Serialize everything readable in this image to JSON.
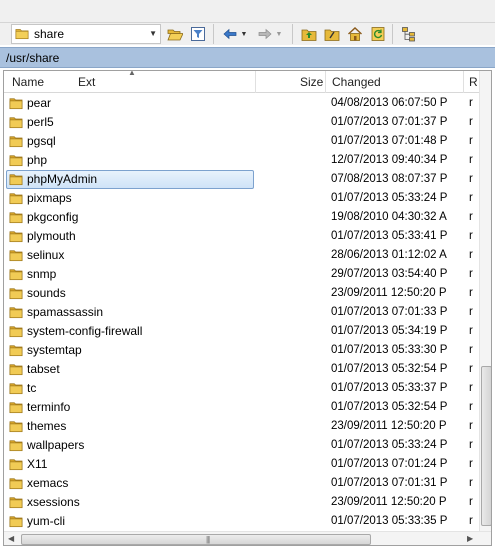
{
  "toolbar": {
    "location": "share",
    "buttons": [
      "folder-open",
      "filter",
      "back",
      "forward",
      "parent-folder",
      "root-folder",
      "home",
      "refresh",
      "tree-view"
    ]
  },
  "path": "/usr/share",
  "columns": {
    "name": "Name",
    "ext": "Ext",
    "size": "Size",
    "changed": "Changed",
    "rights": "R"
  },
  "files": [
    {
      "name": "pear",
      "changed": "04/08/2013 06:07:50 P",
      "rights": "r"
    },
    {
      "name": "perl5",
      "changed": "01/07/2013 07:01:37 P",
      "rights": "r"
    },
    {
      "name": "pgsql",
      "changed": "01/07/2013 07:01:48 P",
      "rights": "r"
    },
    {
      "name": "php",
      "changed": "12/07/2013 09:40:34 P",
      "rights": "r"
    },
    {
      "name": "phpMyAdmin",
      "changed": "07/08/2013 08:07:37 P",
      "rights": "r",
      "selected": true
    },
    {
      "name": "pixmaps",
      "changed": "01/07/2013 05:33:24 P",
      "rights": "r"
    },
    {
      "name": "pkgconfig",
      "changed": "19/08/2010 04:30:32 A",
      "rights": "r"
    },
    {
      "name": "plymouth",
      "changed": "01/07/2013 05:33:41 P",
      "rights": "r"
    },
    {
      "name": "selinux",
      "changed": "28/06/2013 01:12:02 A",
      "rights": "r"
    },
    {
      "name": "snmp",
      "changed": "29/07/2013 03:54:40 P",
      "rights": "r"
    },
    {
      "name": "sounds",
      "changed": "23/09/2011 12:50:20 P",
      "rights": "r"
    },
    {
      "name": "spamassassin",
      "changed": "01/07/2013 07:01:33 P",
      "rights": "r"
    },
    {
      "name": "system-config-firewall",
      "changed": "01/07/2013 05:34:19 P",
      "rights": "r"
    },
    {
      "name": "systemtap",
      "changed": "01/07/2013 05:33:30 P",
      "rights": "r"
    },
    {
      "name": "tabset",
      "changed": "01/07/2013 05:32:54 P",
      "rights": "r"
    },
    {
      "name": "tc",
      "changed": "01/07/2013 05:33:37 P",
      "rights": "r"
    },
    {
      "name": "terminfo",
      "changed": "01/07/2013 05:32:54 P",
      "rights": "r"
    },
    {
      "name": "themes",
      "changed": "23/09/2011 12:50:20 P",
      "rights": "r"
    },
    {
      "name": "wallpapers",
      "changed": "01/07/2013 05:33:24 P",
      "rights": "r"
    },
    {
      "name": "X11",
      "changed": "01/07/2013 07:01:24 P",
      "rights": "r"
    },
    {
      "name": "xemacs",
      "changed": "01/07/2013 07:01:31 P",
      "rights": "r"
    },
    {
      "name": "xsessions",
      "changed": "23/09/2011 12:50:20 P",
      "rights": "r"
    },
    {
      "name": "yum-cli",
      "changed": "01/07/2013 05:33:35 P",
      "rights": "r"
    }
  ],
  "colors": {
    "pathbar": "#a9c1de",
    "folder": "#e6b93a",
    "selection": "#cfe3f7"
  }
}
